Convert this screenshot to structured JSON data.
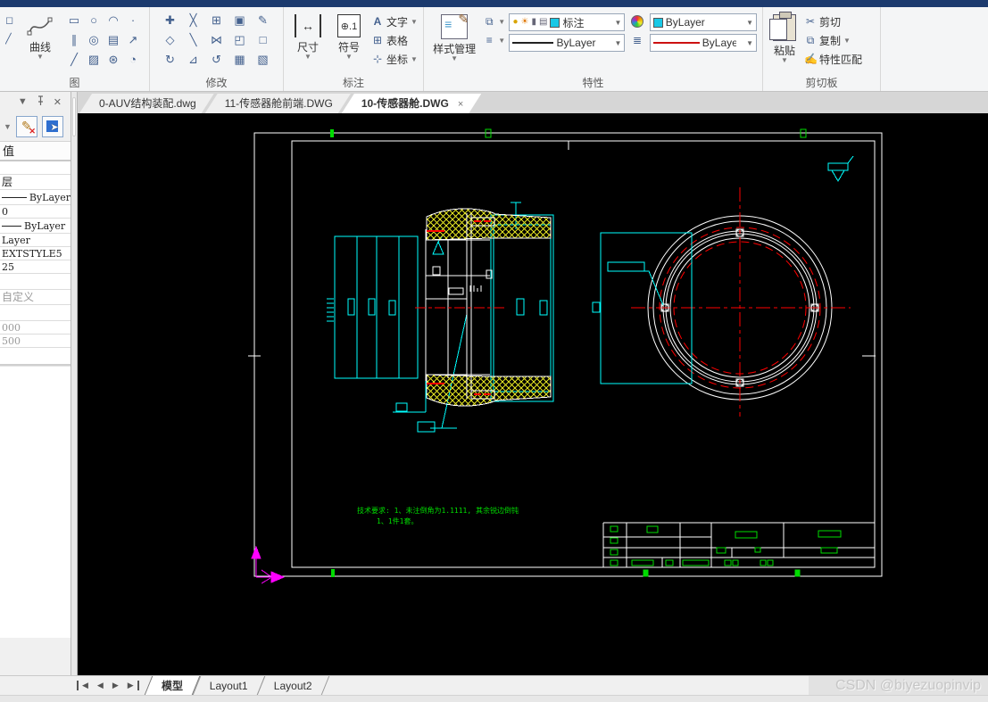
{
  "ribbon": {
    "group_draw": {
      "label": "图",
      "curve_button": "曲线"
    },
    "group_modify": {
      "label": "修改"
    },
    "group_annotate": {
      "label": "标注",
      "dim_button": "尺寸",
      "symbol_button": "符号",
      "symbol_glyph": "⊕.1",
      "text_item": "文字",
      "table_item": "表格",
      "coord_item": "坐标"
    },
    "group_properties": {
      "label": "特性",
      "style_button": "样式管理",
      "layer_value": "标注",
      "color_value": "ByLayer",
      "linetype_value": "ByLayer",
      "lineweight_value": "ByLayer"
    },
    "group_clipboard": {
      "label": "剪切板",
      "paste_button": "粘贴",
      "cut_item": "剪切",
      "copy_item": "复制",
      "match_item": "特性匹配"
    }
  },
  "icons": {
    "draw_grid": [
      "▭",
      "○",
      "◠",
      "·",
      "∥",
      "◎",
      "▤",
      "↗",
      "╱",
      "▨",
      "⊛",
      "◔"
    ],
    "modify_grid": [
      "✚",
      "╳",
      "⊞",
      "▣",
      "✎",
      "◇",
      "╲",
      "⋈",
      "◰",
      "□",
      "↻",
      "⊿",
      "↺",
      "▦",
      "▧"
    ],
    "text_icon": "A",
    "table_icon": "⊞",
    "coord_icon": "⊹",
    "cut_icon": "✂",
    "copy_icon": "⧉",
    "match_icon": "✍",
    "layer_lamp": "●",
    "layer_sun": "☀",
    "layer_lock": "▮",
    "layer_print": "▤",
    "style_small": "≡",
    "lineweight_icon": "≣"
  },
  "doc_tabs": [
    {
      "label": "0-AUV结构装配.dwg",
      "active": false
    },
    {
      "label": "11-传感器舱前端.DWG",
      "active": false
    },
    {
      "label": "10-传感器舱.DWG",
      "active": true,
      "close": "×"
    }
  ],
  "left_panel": {
    "value_header": "值",
    "rows": [
      {
        "text": ""
      },
      {
        "text": "层"
      },
      {
        "text": "ByLayer",
        "swatch": "long"
      },
      {
        "text": "0"
      },
      {
        "text": "ByLayer",
        "swatch": "short"
      },
      {
        "text": "Layer"
      },
      {
        "text": "EXTSTYLE5"
      },
      {
        "text": "25"
      },
      {
        "text": ""
      },
      {
        "text": "自定义",
        "dim": true
      },
      {
        "text": ""
      },
      {
        "text": "000",
        "dim": true
      },
      {
        "text": "500",
        "dim": true
      },
      {
        "text": ""
      }
    ]
  },
  "canvas": {
    "tech_note_line1": "技术要求: 1、未注倒角为1.1111, 其余锐边倒钝",
    "tech_note_line2": "1、1件1套。",
    "colors": {
      "background": "#000000",
      "geometry_cyan": "#00ffff",
      "geometry_white": "#ffffff",
      "centerline_red": "#ff0000",
      "hatch_yellow": "#dddd22",
      "annotation_green": "#00dd00",
      "ucs_magenta": "#ff00ff"
    }
  },
  "status_bar": {
    "layout_tabs": [
      {
        "label": "模型",
        "active": true
      },
      {
        "label": "Layout1",
        "active": false
      },
      {
        "label": "Layout2",
        "active": false
      }
    ],
    "watermark": "CSDN @biyezuopinvip"
  }
}
